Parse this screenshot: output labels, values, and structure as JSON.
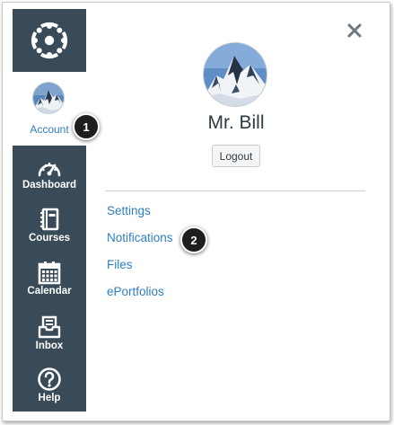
{
  "nav": {
    "logo_icon": "canvas-logo-icon",
    "account": {
      "label": "Account",
      "icon": "avatar-mountain"
    },
    "items": [
      {
        "label": "Dashboard",
        "icon": "dashboard-icon"
      },
      {
        "label": "Courses",
        "icon": "courses-icon"
      },
      {
        "label": "Calendar",
        "icon": "calendar-icon"
      },
      {
        "label": "Inbox",
        "icon": "inbox-icon"
      },
      {
        "label": "Help",
        "icon": "help-icon"
      }
    ]
  },
  "tray": {
    "user_name": "Mr. Bill",
    "logout_label": "Logout",
    "close_icon": "close-icon",
    "links": [
      "Settings",
      "Notifications",
      "Files",
      "ePortfolios"
    ]
  },
  "callouts": [
    "1",
    "2"
  ],
  "colors": {
    "nav_bg": "#394b58",
    "link": "#2d7fc2",
    "text": "#2d3b45",
    "callout_bg": "#1e1e1e"
  }
}
